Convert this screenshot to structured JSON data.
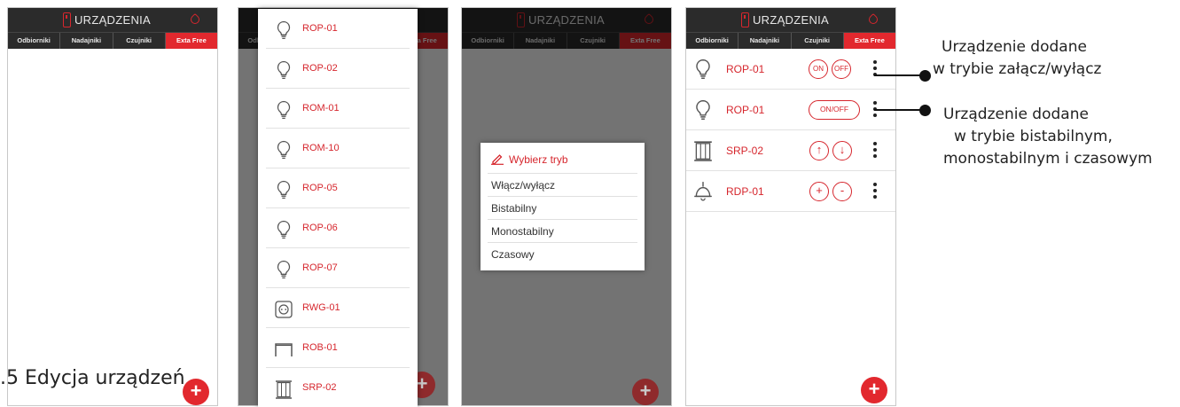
{
  "app": {
    "title": "URZĄDZENIA"
  },
  "tabs": [
    "Odbiorniki",
    "Nadajniki",
    "Czujniki",
    "Exta Free"
  ],
  "accent_color": "#e2282e",
  "caption": ".5 Edycja urządzeń",
  "fab_label": "+",
  "picker_items": [
    {
      "name": "ROP-01",
      "icon": "bulb-icon"
    },
    {
      "name": "ROP-02",
      "icon": "bulb-icon"
    },
    {
      "name": "ROM-01",
      "icon": "bulb-icon"
    },
    {
      "name": "ROM-10",
      "icon": "bulb-icon"
    },
    {
      "name": "ROP-05",
      "icon": "bulb-icon"
    },
    {
      "name": "ROP-06",
      "icon": "bulb-icon"
    },
    {
      "name": "ROP-07",
      "icon": "bulb-icon"
    },
    {
      "name": "RWG-01",
      "icon": "socket-icon"
    },
    {
      "name": "ROB-01",
      "icon": "gate-icon"
    },
    {
      "name": "SRP-02",
      "icon": "blinds-icon"
    }
  ],
  "mode_dialog": {
    "title": "Wybierz tryb",
    "options": [
      "Włącz/wyłącz",
      "Bistabilny",
      "Monostabilny",
      "Czasowy"
    ]
  },
  "devices": [
    {
      "name": "ROP-01",
      "icon": "bulb-icon",
      "controls": [
        "ON",
        "OFF"
      ]
    },
    {
      "name": "ROP-01",
      "icon": "bulb-icon",
      "controls": [
        "ON/OFF"
      ]
    },
    {
      "name": "SRP-02",
      "icon": "blinds-icon",
      "controls": [
        "↑",
        "↓"
      ]
    },
    {
      "name": "RDP-01",
      "icon": "lamp-icon",
      "controls": [
        "+",
        "-"
      ]
    }
  ],
  "annotations": [
    {
      "line1": "Urządzenie dodane",
      "line2": "w trybie załącz/wyłącz"
    },
    {
      "line1": "Urządzenie dodane",
      "line2": "w trybie bistabilnym,",
      "line3": "monostabilnym i czasowym"
    }
  ]
}
